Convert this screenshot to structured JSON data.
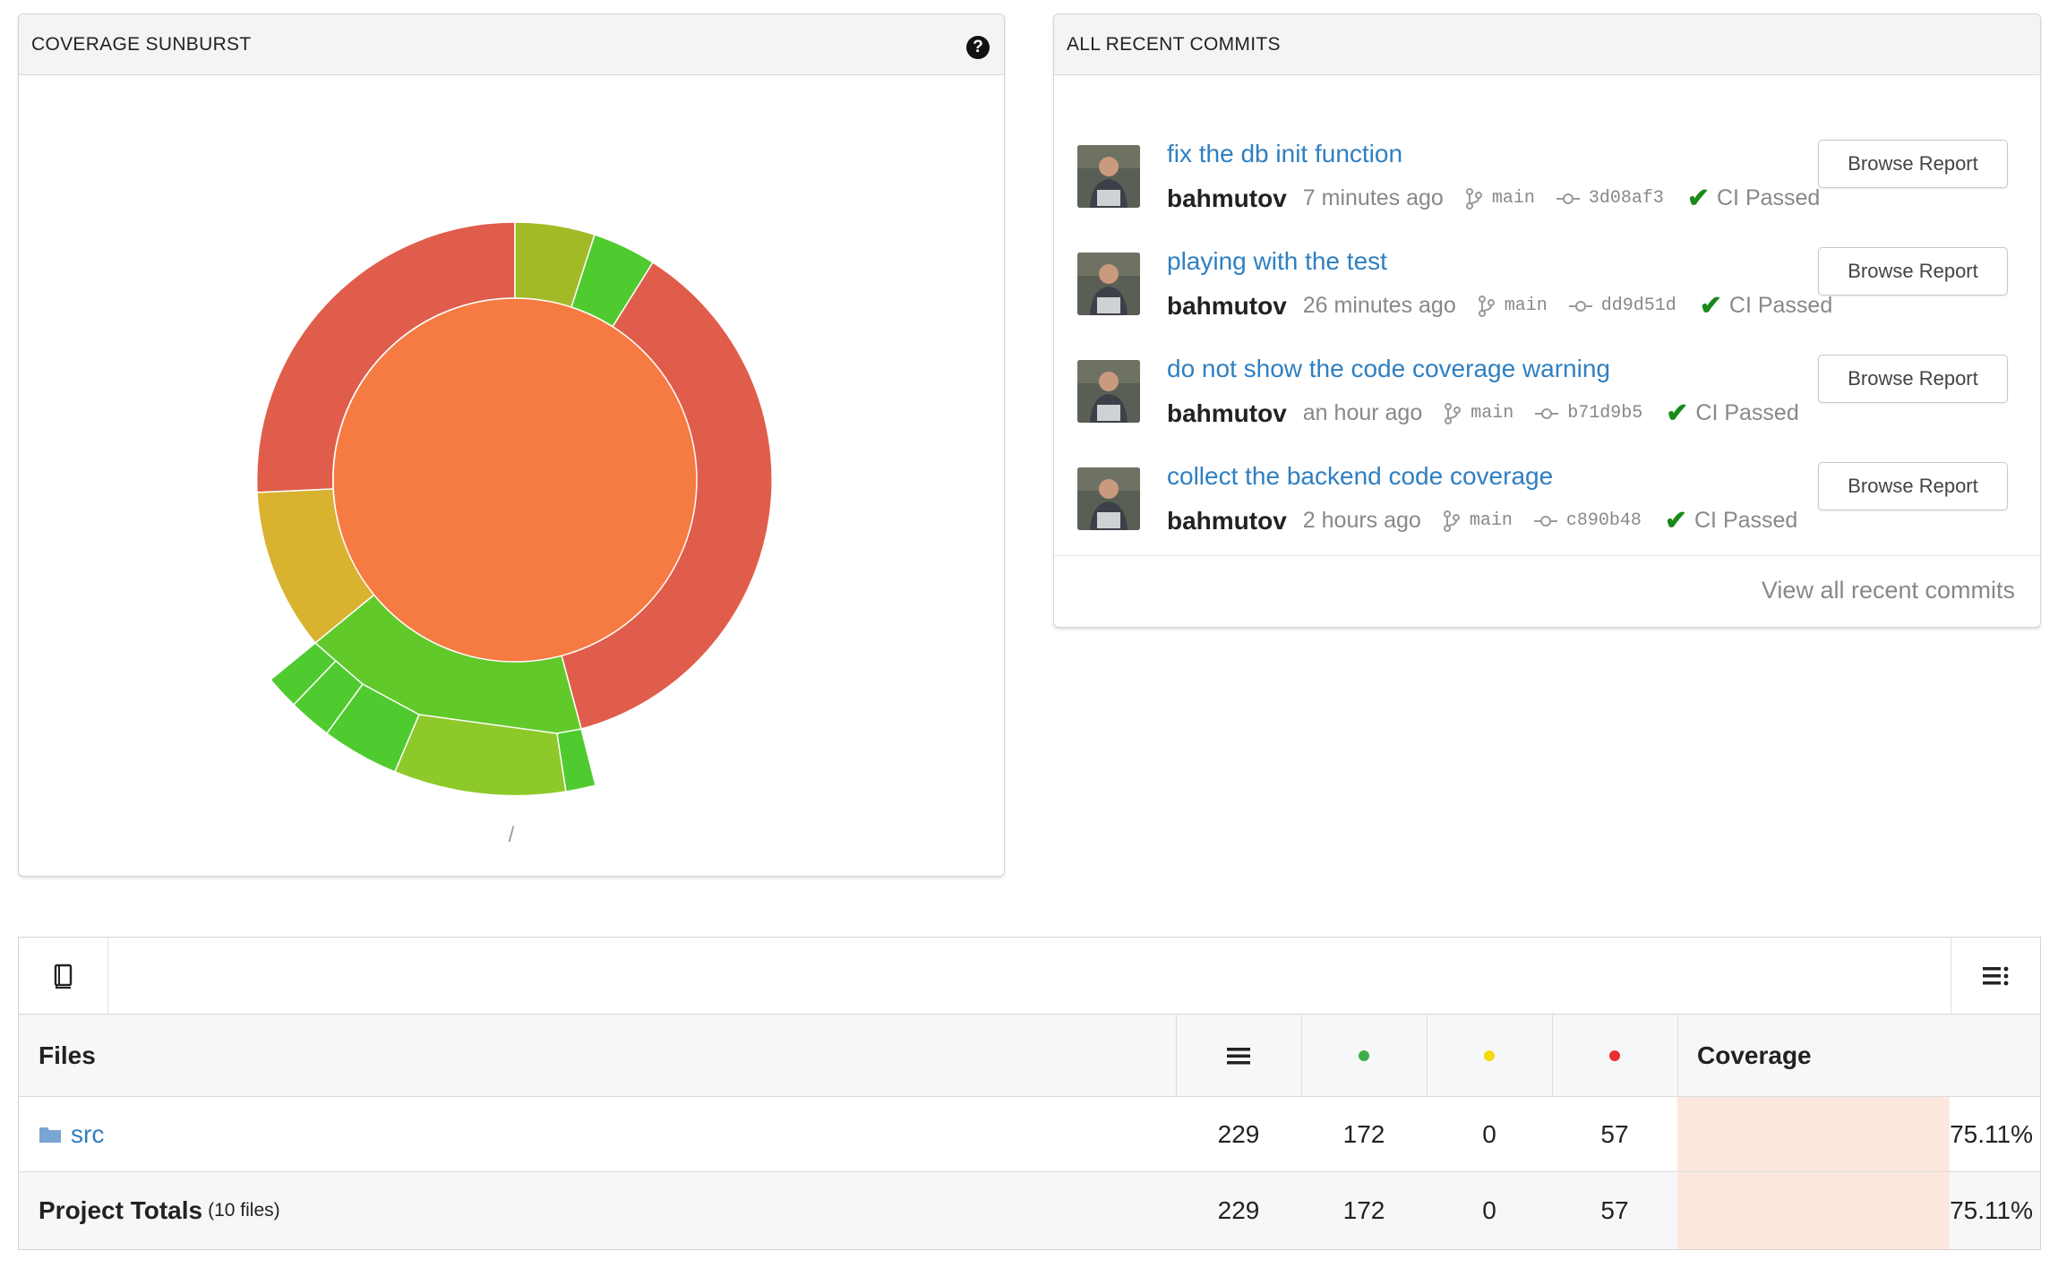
{
  "sunburst_panel": {
    "title": "COVERAGE SUNBURST",
    "help_icon": "question-circle-icon",
    "path_label": "/",
    "colors": {
      "red": "#e05d4b",
      "orange": "#f67b42",
      "yellow": "#d9b22f",
      "olive": "#a3ba27",
      "light_green": "#8ec92a",
      "green": "#62c92b",
      "bright_green": "#4fcb2f"
    }
  },
  "commits_panel": {
    "title": "ALL RECENT COMMITS",
    "commits": [
      {
        "message": "fix the db init function",
        "author": "bahmutov",
        "time": "7 minutes ago",
        "branch": "main",
        "sha": "3d08af3",
        "ci": "CI Passed",
        "button": "Browse Report"
      },
      {
        "message": "playing with the test",
        "author": "bahmutov",
        "time": "26 minutes ago",
        "branch": "main",
        "sha": "dd9d51d",
        "ci": "CI Passed",
        "button": "Browse Report"
      },
      {
        "message": "do not show the code coverage warning",
        "author": "bahmutov",
        "time": "an hour ago",
        "branch": "main",
        "sha": "b71d9b5",
        "ci": "CI Passed",
        "button": "Browse Report"
      },
      {
        "message": "collect the backend code coverage",
        "author": "bahmutov",
        "time": "2 hours ago",
        "branch": "main",
        "sha": "c890b48",
        "ci": "CI Passed",
        "button": "Browse Report"
      }
    ],
    "view_all": "View all recent commits"
  },
  "files_table": {
    "toolbar_left_icon": "book-icon",
    "toolbar_right_icon": "list-settings-icon",
    "headers": {
      "files": "Files",
      "lines_icon": "lines-icon",
      "hit_color": "#3fae49",
      "partial_color": "#f5d90a",
      "miss_color": "#e8302f",
      "coverage": "Coverage"
    },
    "rows": [
      {
        "name": "src",
        "icon": "folder-icon",
        "lines": "229",
        "hit": "172",
        "partial": "0",
        "miss": "57",
        "coverage": "75.11%",
        "coverage_value": 75.11
      }
    ],
    "totals": {
      "label": "Project Totals",
      "files_note": "(10 files)",
      "lines": "229",
      "hit": "172",
      "partial": "0",
      "miss": "57",
      "coverage": "75.11%",
      "coverage_value": 75.11
    }
  }
}
